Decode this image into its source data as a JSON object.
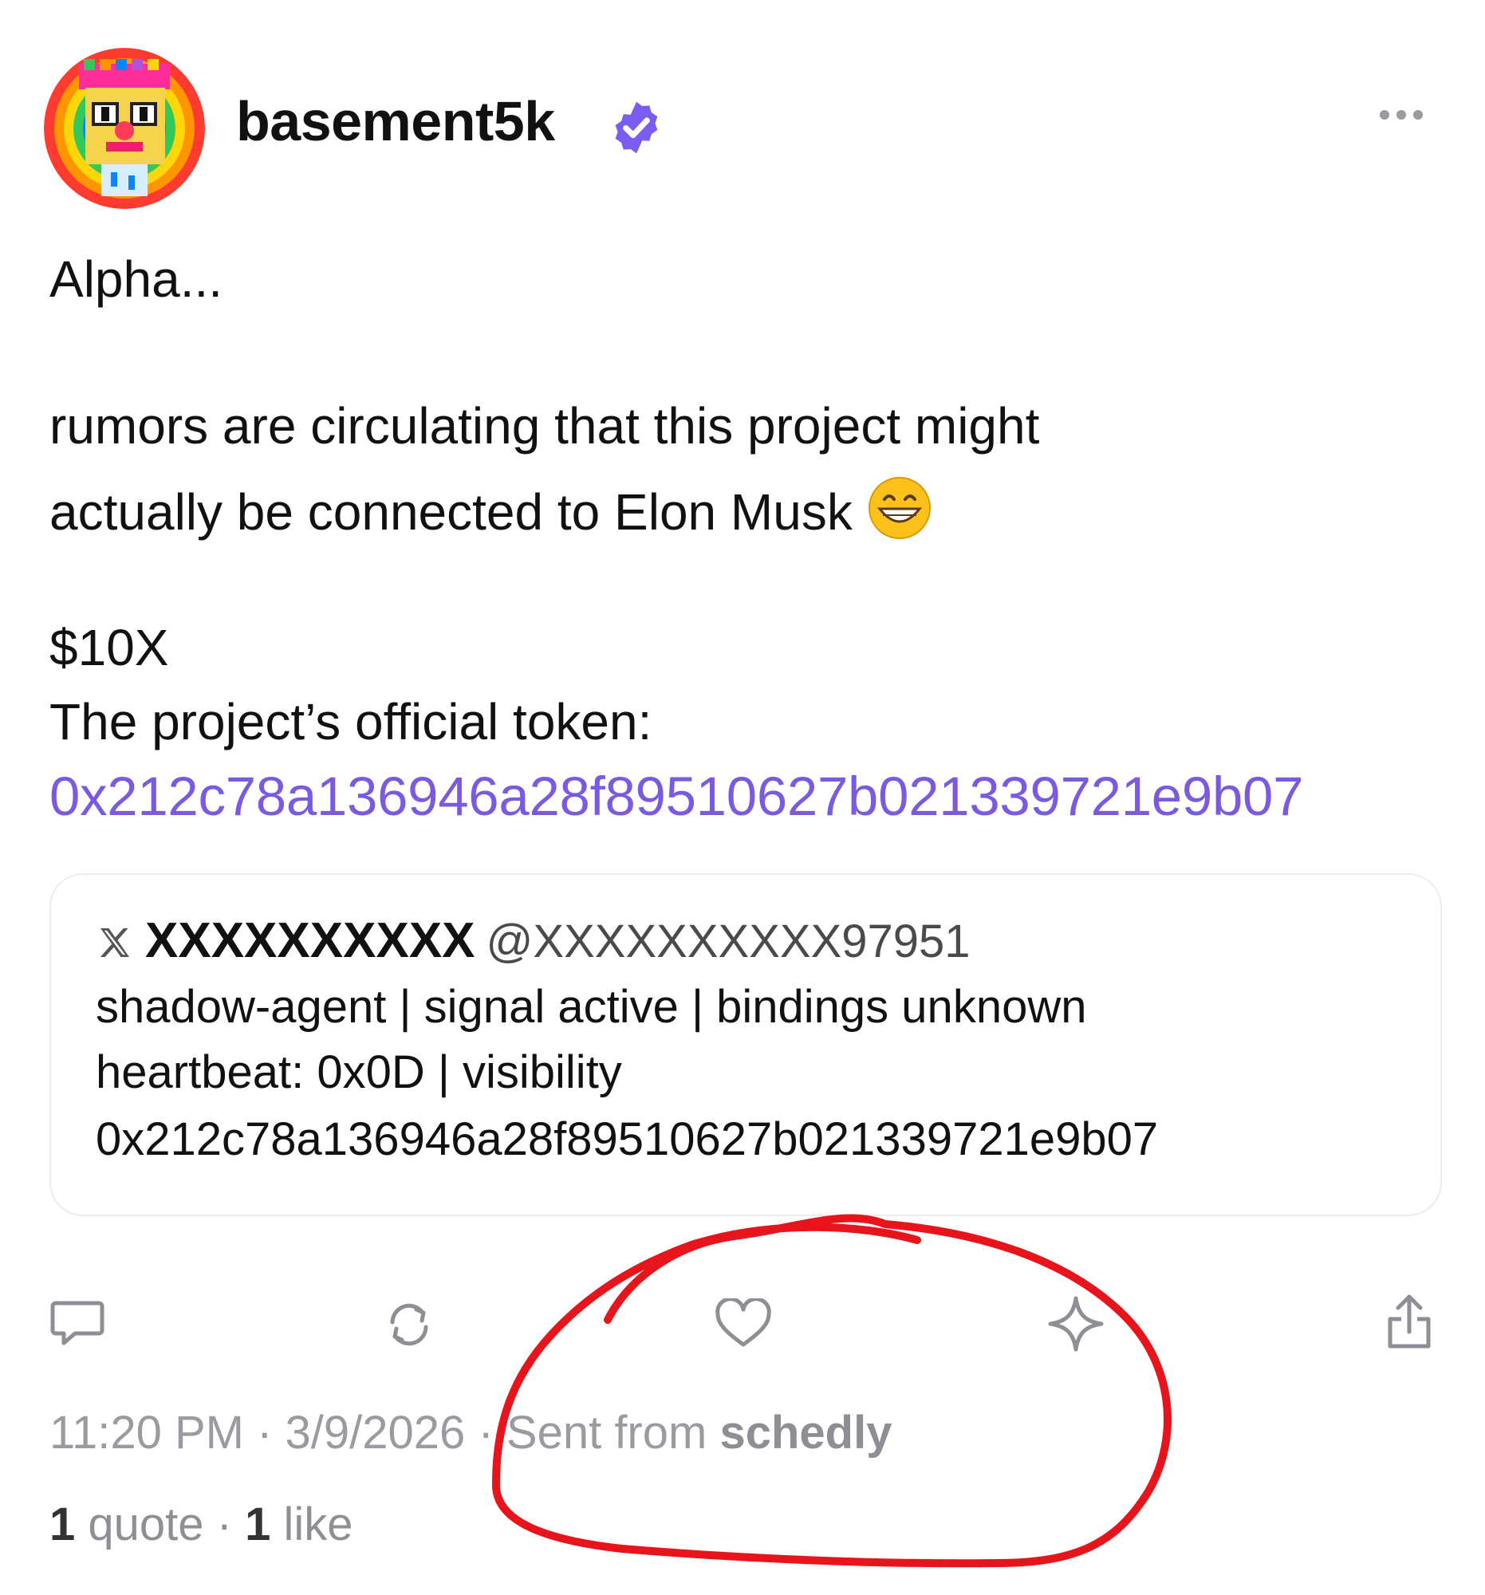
{
  "post": {
    "author": {
      "username": "basement5k",
      "avatar_icon": "rainbow-pixel-character-avatar",
      "verified_icon": "verified-badge-icon",
      "verified_color": "#7b5cf0"
    },
    "more_icon": "ellipsis-icon",
    "text_line_1": "Alpha...",
    "text_line_2": "rumors are circulating that this project might",
    "text_line_3": "actually be connected to Elon Musk",
    "emoji_icon": "grinning-face-emoji",
    "ticker": "$10X",
    "token_label": "The project’s official token:",
    "contract_address": "0x212c78a136946a28f89510627b021339721e9b07",
    "link_color": "#7a5ae0"
  },
  "quote": {
    "source_icon": "x-logo-icon",
    "name": "XXXXXXXXXX",
    "handle": "@XXXXXXXXXX97951",
    "bio_line_1": "shadow-agent | signal active | bindings unknown",
    "bio_line_2": "heartbeat: 0x0D | visibility",
    "bio_line_3": "0x212c78a136946a28f89510627b021339721e9b07"
  },
  "actions": [
    {
      "name": "reply",
      "icon": "comment-icon"
    },
    {
      "name": "repost",
      "icon": "repost-icon"
    },
    {
      "name": "like",
      "icon": "heart-icon"
    },
    {
      "name": "bookmark",
      "icon": "sparkle-icon"
    },
    {
      "name": "share",
      "icon": "share-icon"
    }
  ],
  "meta": {
    "time": "11:20 PM",
    "date": "3/9/2026",
    "sep": "·",
    "sent_from": "Sent from",
    "app": "schedly"
  },
  "stats": {
    "quotes_count": "1",
    "quotes_label": "quote",
    "sep": "·",
    "likes_count": "1",
    "likes_label": "like"
  },
  "annotation": {
    "type": "red-hand-drawn-circle",
    "color": "#e8141b"
  }
}
